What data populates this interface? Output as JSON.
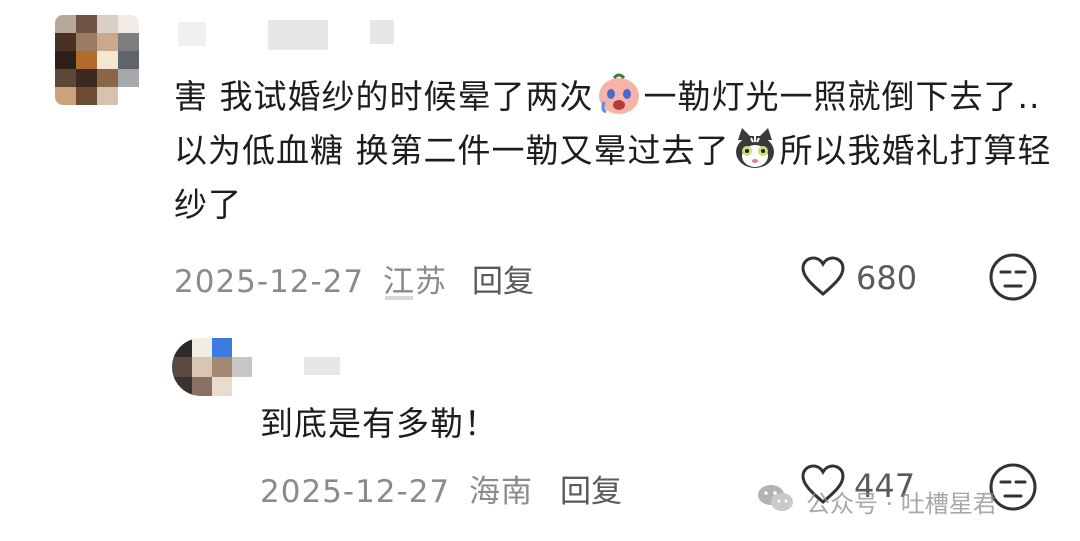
{
  "comments": [
    {
      "text_parts": [
        "害 我试婚纱的时候晕了两次",
        "一勒灯光一照就倒下去了..以为低血糖 换第二件一勒又晕过去了",
        "所以我婚礼打算轻纱了"
      ],
      "date": "2025-12-27",
      "location": "江苏",
      "reply_label": "回复",
      "likes": "680"
    },
    {
      "text": "到底是有多勒！",
      "date": "2025-12-27",
      "location": "海南",
      "reply_label": "回复",
      "likes": "447"
    }
  ],
  "watermark": {
    "text": "公众号 · 吐槽星君",
    "icon": "wechat-icon"
  },
  "icons": {
    "like": "heart-icon",
    "dislike": "unamused-face-icon",
    "emoji1": "crying-face-emoji",
    "emoji2": "shocked-cat-emoji"
  }
}
